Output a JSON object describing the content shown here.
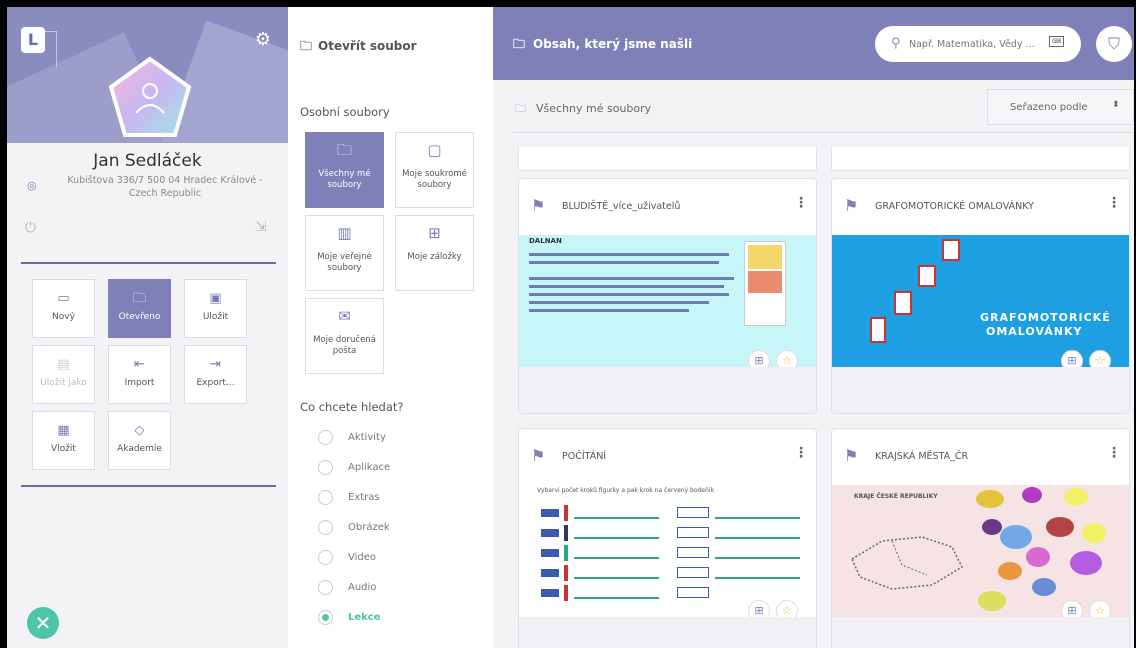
{
  "profile": {
    "name": "Jan Sedláček",
    "address": "Kubištova 336/7 500 04 Hradec Králové - Czech Republic"
  },
  "menu": [
    {
      "label": "Nový",
      "icon": "monitor-icon",
      "state": "normal"
    },
    {
      "label": "Otevřeno",
      "icon": "folder-open-icon",
      "state": "active"
    },
    {
      "label": "Uložit",
      "icon": "save-icon",
      "state": "normal"
    },
    {
      "label": "Uložit jako",
      "icon": "save-as-icon",
      "state": "disabled"
    },
    {
      "label": "Import",
      "icon": "import-icon",
      "state": "normal"
    },
    {
      "label": "Export...",
      "icon": "export-icon",
      "state": "normal"
    },
    {
      "label": "Vložit",
      "icon": "insert-image-icon",
      "state": "normal"
    },
    {
      "label": "Akademie",
      "icon": "graduation-cap-icon",
      "state": "normal"
    }
  ],
  "middle": {
    "title": "Otevřít soubor",
    "personal_heading": "Osobní soubory",
    "file_tiles": [
      {
        "label": "Všechny mé soubory",
        "icon": "folders-icon",
        "active": true
      },
      {
        "label": "Moje soukromé soubory",
        "icon": "private-folder-icon",
        "active": false
      },
      {
        "label": "Moje veřejné soubory",
        "icon": "public-folder-icon",
        "active": false
      },
      {
        "label": "Moje záložky",
        "icon": "bookmark-icon",
        "active": false
      },
      {
        "label": "Moje doručená pošta",
        "icon": "inbox-icon",
        "active": false
      }
    ],
    "search_heading": "Co chcete hledat?",
    "filters": [
      {
        "label": "Aktivity",
        "selected": false
      },
      {
        "label": "Aplikace",
        "selected": false
      },
      {
        "label": "Extras",
        "selected": false
      },
      {
        "label": "Obrázek",
        "selected": false
      },
      {
        "label": "Video",
        "selected": false
      },
      {
        "label": "Audio",
        "selected": false
      },
      {
        "label": "Lekce",
        "selected": true
      }
    ]
  },
  "right": {
    "title": "Obsah, který jsme našli",
    "search_placeholder": "Např. Matematika, Vědy ...",
    "section_label": "Všechny mé soubory",
    "sort_label": "Seřazeno podle",
    "cards": [
      {
        "title": "BLUDIŠTĚ_více_uživatelů"
      },
      {
        "title": "GRAFOMOTORICKÉ OMALOVÁNKY"
      },
      {
        "title": "POČÍTÁNÍ"
      },
      {
        "title": "KRAJSKÁ MĚSTA_ČR"
      }
    ],
    "thumb_text": {
      "grafo_line1": "GRAFOMOTORICKÉ",
      "grafo_line2": "OMALOVÁNKY",
      "bludiste_heading": "DALNAN",
      "pocitani_heading": "Vybarvi počet kroků figurky a pak krok na červený bodeňik",
      "kraje_heading": "KRAJE ČESKÉ REPUBLIKY"
    }
  },
  "colors": {
    "accent": "#7f80b8",
    "green": "#4ec5a8",
    "star": "#e9b22c"
  }
}
